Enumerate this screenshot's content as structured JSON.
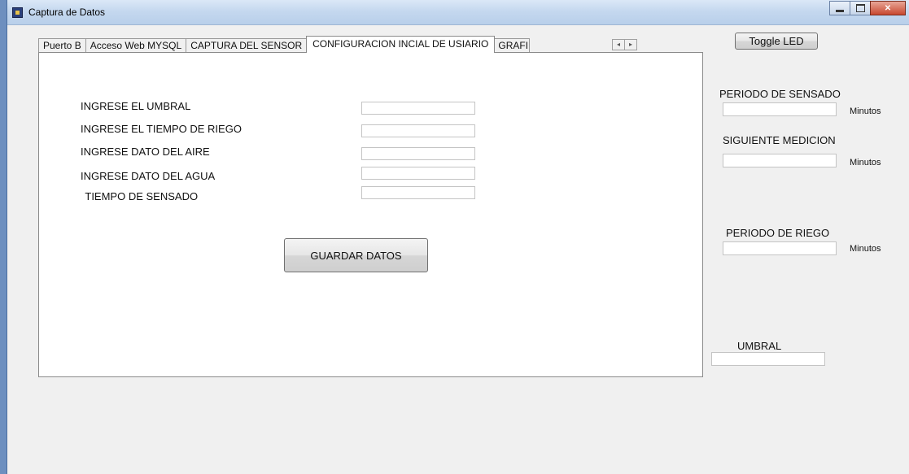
{
  "window": {
    "title": "Captura de Datos"
  },
  "tabs": [
    "Puerto B",
    "Acceso Web MYSQL",
    "CAPTURA DEL SENSOR",
    "CONFIGURACION INCIAL DE USIARIO",
    "GRAFI"
  ],
  "form": {
    "labels": [
      "INGRESE EL UMBRAL",
      "INGRESE EL TIEMPO DE RIEGO",
      "INGRESE DATO DEL AIRE",
      "INGRESE DATO DEL AGUA",
      " TIEMPO DE SENSADO"
    ],
    "values": [
      "",
      "",
      "",
      "",
      ""
    ],
    "save_button": "GUARDAR DATOS"
  },
  "side": {
    "toggle_button": "Toggle LED",
    "periodo_sensado_label": "PERIODO DE SENSADO",
    "periodo_sensado_value": "",
    "siguiente_medicion_label": "SIGUIENTE MEDICION",
    "siguiente_medicion_value": "",
    "periodo_riego_label": "PERIODO DE RIEGO",
    "periodo_riego_value": "",
    "umbral_label": "UMBRAL",
    "umbral_value": "",
    "unit": "Minutos"
  }
}
